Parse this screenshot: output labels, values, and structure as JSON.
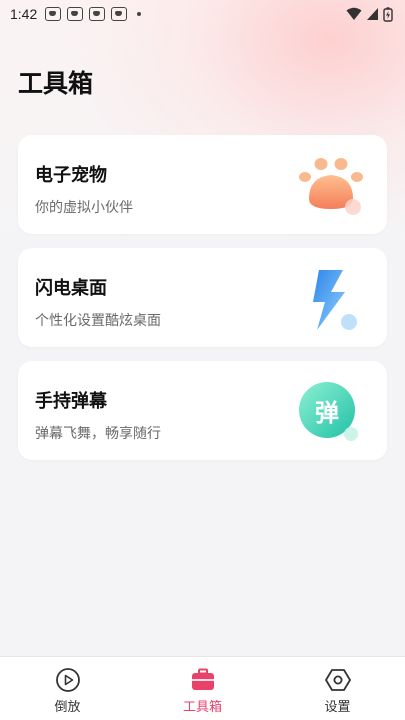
{
  "status_bar": {
    "time": "1:42",
    "notification_icons": [
      "paw-notification-icon",
      "paw-notification-icon",
      "paw-notification-icon",
      "paw-notification-icon"
    ],
    "right_icons": [
      "wifi-icon",
      "signal-icon",
      "battery-icon"
    ]
  },
  "page": {
    "title": "工具箱"
  },
  "cards": [
    {
      "title": "电子宠物",
      "subtitle": "你的虚拟小伙伴",
      "icon": "paw-icon"
    },
    {
      "title": "闪电桌面",
      "subtitle": "个性化设置酷炫桌面",
      "icon": "lightning-icon"
    },
    {
      "title": "手持弹幕",
      "subtitle": "弹幕飞舞，畅享随行",
      "icon": "danmu-icon",
      "icon_text": "弹"
    }
  ],
  "tabbar": {
    "items": [
      {
        "label": "倒放",
        "icon": "play-circle-icon",
        "active": false
      },
      {
        "label": "工具箱",
        "icon": "toolbox-icon",
        "active": true
      },
      {
        "label": "设置",
        "icon": "settings-hexagon-icon",
        "active": false
      }
    ]
  },
  "colors": {
    "accent": "#e8426b",
    "paw": "#f59a6a",
    "lightning": "#4aa8f0",
    "danmu": "#3ed3b8"
  }
}
